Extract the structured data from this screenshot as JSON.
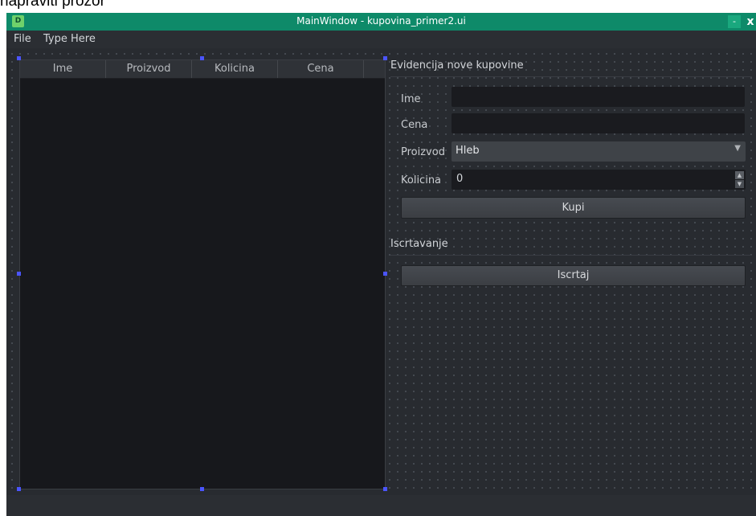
{
  "caption": "napraviti prozor",
  "window": {
    "title": "MainWindow - kupovina_primer2.ui",
    "icon": "app-icon",
    "minimize_symbol": "-",
    "close_symbol": "x"
  },
  "menubar": {
    "items": [
      "File",
      "Type Here"
    ]
  },
  "table": {
    "columns": [
      "Ime",
      "Proizvod",
      "Kolicina",
      "Cena"
    ]
  },
  "form": {
    "section_title": "Evidencija nove kupovine",
    "ime_label": "Ime",
    "ime_value": "",
    "cena_label": "Cena",
    "cena_value": "",
    "proizvod_label": "Proizvod",
    "proizvod_selected": "Hleb",
    "kolicina_label": "Kolicina",
    "kolicina_value": "0",
    "kupi_label": "Kupi"
  },
  "drawing": {
    "section_title": "Iscrtavanje",
    "iscrtaj_label": "Iscrtaj"
  },
  "colors": {
    "titlebar": "#0e8a69",
    "background": "#2b2e33",
    "selection_handle": "#4b55ff"
  }
}
